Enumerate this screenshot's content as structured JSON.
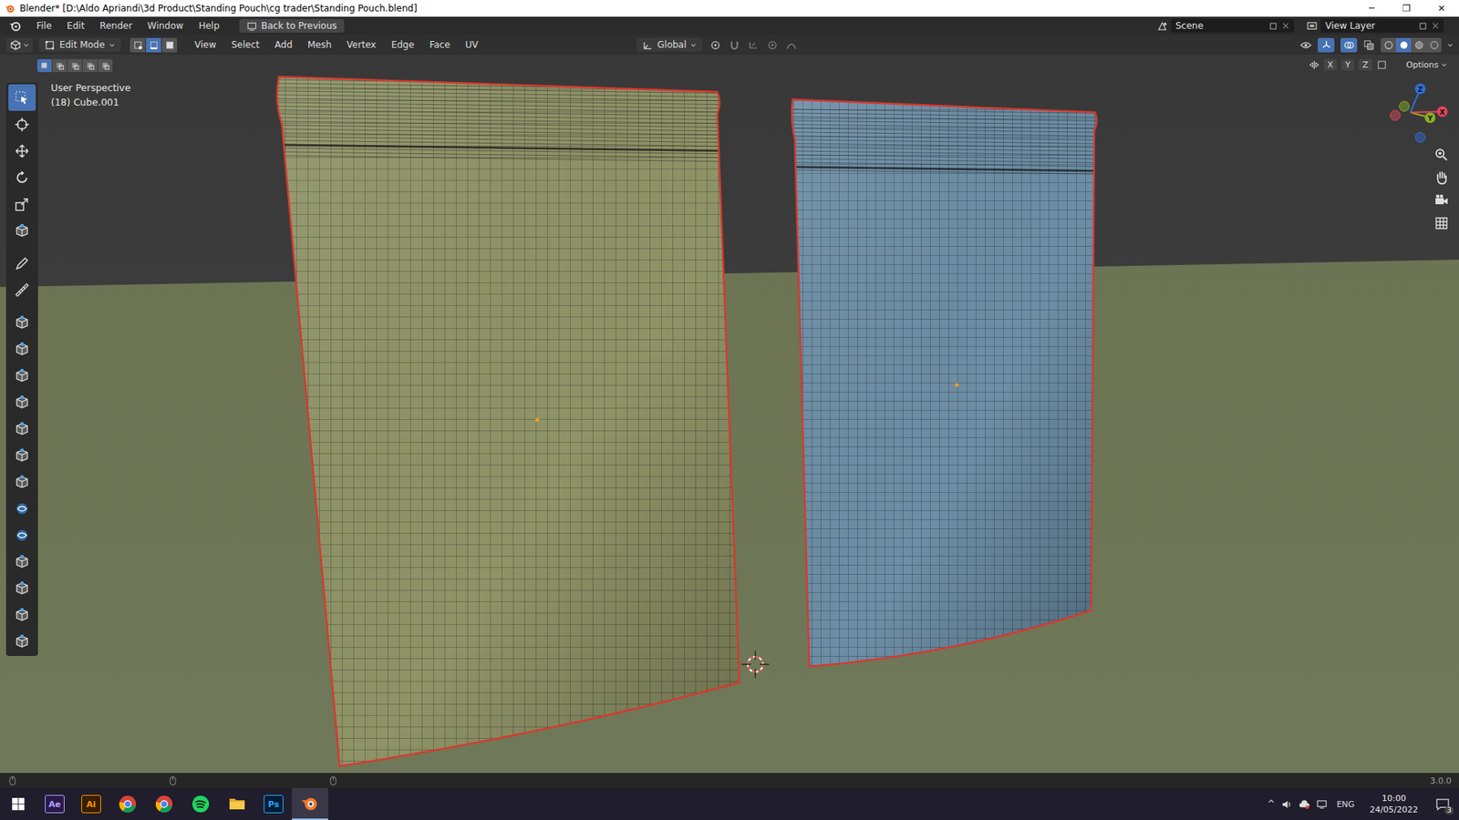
{
  "window": {
    "title": "Blender* [D:\\Aldo Apriandi\\3d Product\\Standing Pouch\\cg trader\\Standing Pouch.blend]",
    "controls": [
      "─",
      "❐",
      "✕"
    ]
  },
  "top_bar": {
    "menus": [
      "File",
      "Edit",
      "Render",
      "Window",
      "Help"
    ],
    "back_button": "Back to Previous",
    "scene": "Scene",
    "view_layer": "View Layer"
  },
  "header": {
    "mode": "Edit Mode",
    "select_modes": [
      {
        "kind": "vertex",
        "selected": false
      },
      {
        "kind": "edge",
        "selected": true
      },
      {
        "kind": "face",
        "selected": false
      }
    ],
    "menus": [
      "View",
      "Select",
      "Add",
      "Mesh",
      "Vertex",
      "Edge",
      "Face",
      "UV"
    ],
    "orientation": "Global",
    "shading": [
      {
        "kind": "wireframe",
        "selected": false
      },
      {
        "kind": "solid",
        "selected": true
      },
      {
        "kind": "material",
        "selected": false
      },
      {
        "kind": "rendered",
        "selected": false
      }
    ]
  },
  "tool_settings": {
    "box_modes": [
      {
        "selected": true
      },
      {
        "selected": false
      },
      {
        "selected": false
      },
      {
        "selected": false
      },
      {
        "selected": false
      }
    ],
    "mirror_axes": [
      "X",
      "Y",
      "Z"
    ],
    "options": "Options"
  },
  "viewport": {
    "view": "User Perspective",
    "object": "(18) Cube.001",
    "objects": [
      {
        "color": "#8f9467",
        "selected": true
      },
      {
        "color": "#6c8ea6",
        "selected": true
      }
    ]
  },
  "toolbar": {
    "tools": [
      {
        "kind": "select",
        "selected": true
      },
      {
        "kind": "cursor",
        "selected": false
      },
      {
        "kind": "move",
        "selected": false
      },
      {
        "kind": "rotate",
        "selected": false
      },
      {
        "kind": "scale",
        "selected": false
      },
      {
        "kind": "transform",
        "selected": false
      },
      {
        "kind": "annotate",
        "selected": false
      },
      {
        "kind": "measure",
        "selected": false
      },
      {
        "kind": "add-cube",
        "selected": false
      },
      {
        "kind": "extrude",
        "selected": false
      },
      {
        "kind": "inset",
        "selected": false
      },
      {
        "kind": "bevel",
        "selected": false
      },
      {
        "kind": "loop-cut",
        "selected": false
      },
      {
        "kind": "knife",
        "selected": false
      },
      {
        "kind": "poly-build",
        "selected": false
      },
      {
        "kind": "spin",
        "selected": false
      },
      {
        "kind": "smooth",
        "selected": false
      },
      {
        "kind": "edge-slide",
        "selected": false
      },
      {
        "kind": "shrink",
        "selected": false
      },
      {
        "kind": "shear",
        "selected": false
      },
      {
        "kind": "rip",
        "selected": false
      }
    ]
  },
  "gizmo": {
    "axes": [
      {
        "label": "Z",
        "color": "#2e6fd9"
      },
      {
        "label": "Y",
        "color": "#8ab021"
      },
      {
        "label": "X",
        "color": "#e0465a"
      }
    ]
  },
  "status_bar": {
    "version": "3.0.0"
  },
  "taskbar": {
    "apps": [
      {
        "kind": "ae",
        "label": "Ae",
        "active": false
      },
      {
        "kind": "ai",
        "label": "Ai",
        "active": false
      },
      {
        "kind": "chrome",
        "label": "",
        "active": false
      },
      {
        "kind": "chrome",
        "label": "",
        "active": false
      },
      {
        "kind": "spotify",
        "label": "",
        "active": false
      },
      {
        "kind": "files",
        "label": "",
        "active": false
      },
      {
        "kind": "ps",
        "label": "Ps",
        "active": false
      },
      {
        "kind": "blender",
        "label": "",
        "active": true
      }
    ],
    "tray": {
      "chevron": "^",
      "language": "ENG",
      "time": "10:00",
      "date": "24/05/2022",
      "notifications": "3"
    }
  }
}
